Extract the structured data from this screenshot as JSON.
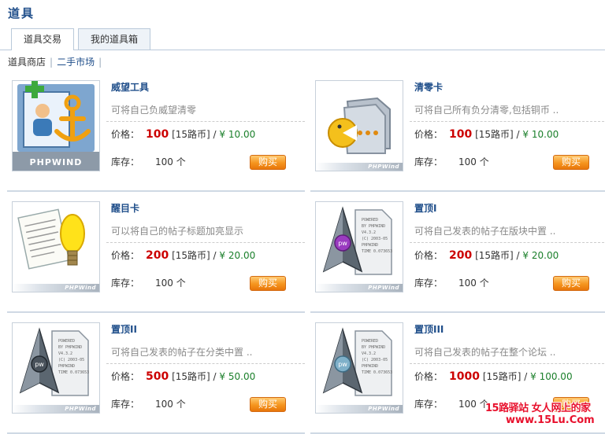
{
  "page_title": "道具",
  "tabs": [
    {
      "label": "道具交易",
      "active": true
    },
    {
      "label": "我的道具箱",
      "active": false
    }
  ],
  "subnav": {
    "shop": "道具商店",
    "sep": "|",
    "market": "二手市场",
    "sep2": "|"
  },
  "labels": {
    "price": "价格：",
    "stock": "库存：",
    "buy": "购买",
    "currency_unit": "[15路币] /",
    "rmb_symbol": "¥"
  },
  "items": [
    {
      "name": "威望工具",
      "desc": "可将自己负威望清零",
      "price": "100",
      "rmb": "¥ 10.00",
      "stock": "100 个",
      "icon": "prestige-tool-icon"
    },
    {
      "name": "清零卡",
      "desc": "可将自己所有负分清零,包括铜币 ..",
      "price": "100",
      "rmb": "¥ 10.00",
      "stock": "100 个",
      "icon": "reset-card-icon"
    },
    {
      "name": "醒目卡",
      "desc": "可以将自己的帖子标题加亮显示",
      "price": "200",
      "rmb": "¥ 20.00",
      "stock": "100 个",
      "icon": "highlight-card-icon"
    },
    {
      "name": "置顶I",
      "desc": "可将自己发表的帖子在版块中置 ..",
      "price": "200",
      "rmb": "¥ 20.00",
      "stock": "100 个",
      "icon": "pin-1-icon"
    },
    {
      "name": "置顶II",
      "desc": "可将自己发表的帖子在分类中置 ..",
      "price": "500",
      "rmb": "¥ 50.00",
      "stock": "100 个",
      "icon": "pin-2-icon"
    },
    {
      "name": "置顶III",
      "desc": "可将自己发表的帖子在整个论坛 ..",
      "price": "1000",
      "rmb": "¥ 100.00",
      "stock": "100 个",
      "icon": "pin-3-icon"
    }
  ],
  "thumb_brand": "PHPWind",
  "thumb_brand_large": "PHPWIND",
  "doc_text_lines": [
    "POWERED",
    "BY PHPWIND",
    "V4.3.2",
    "(C) 2003-05",
    "PHPWIND",
    "TIME 0.073653"
  ],
  "watermark": {
    "line1": "15路驿站 女人网上的家",
    "line2": "www.15Lu.Com"
  },
  "colors": {
    "link": "#1f4e8a",
    "price": "#cc0000",
    "rmb": "#1a7f2a",
    "button": "#f5941e"
  }
}
